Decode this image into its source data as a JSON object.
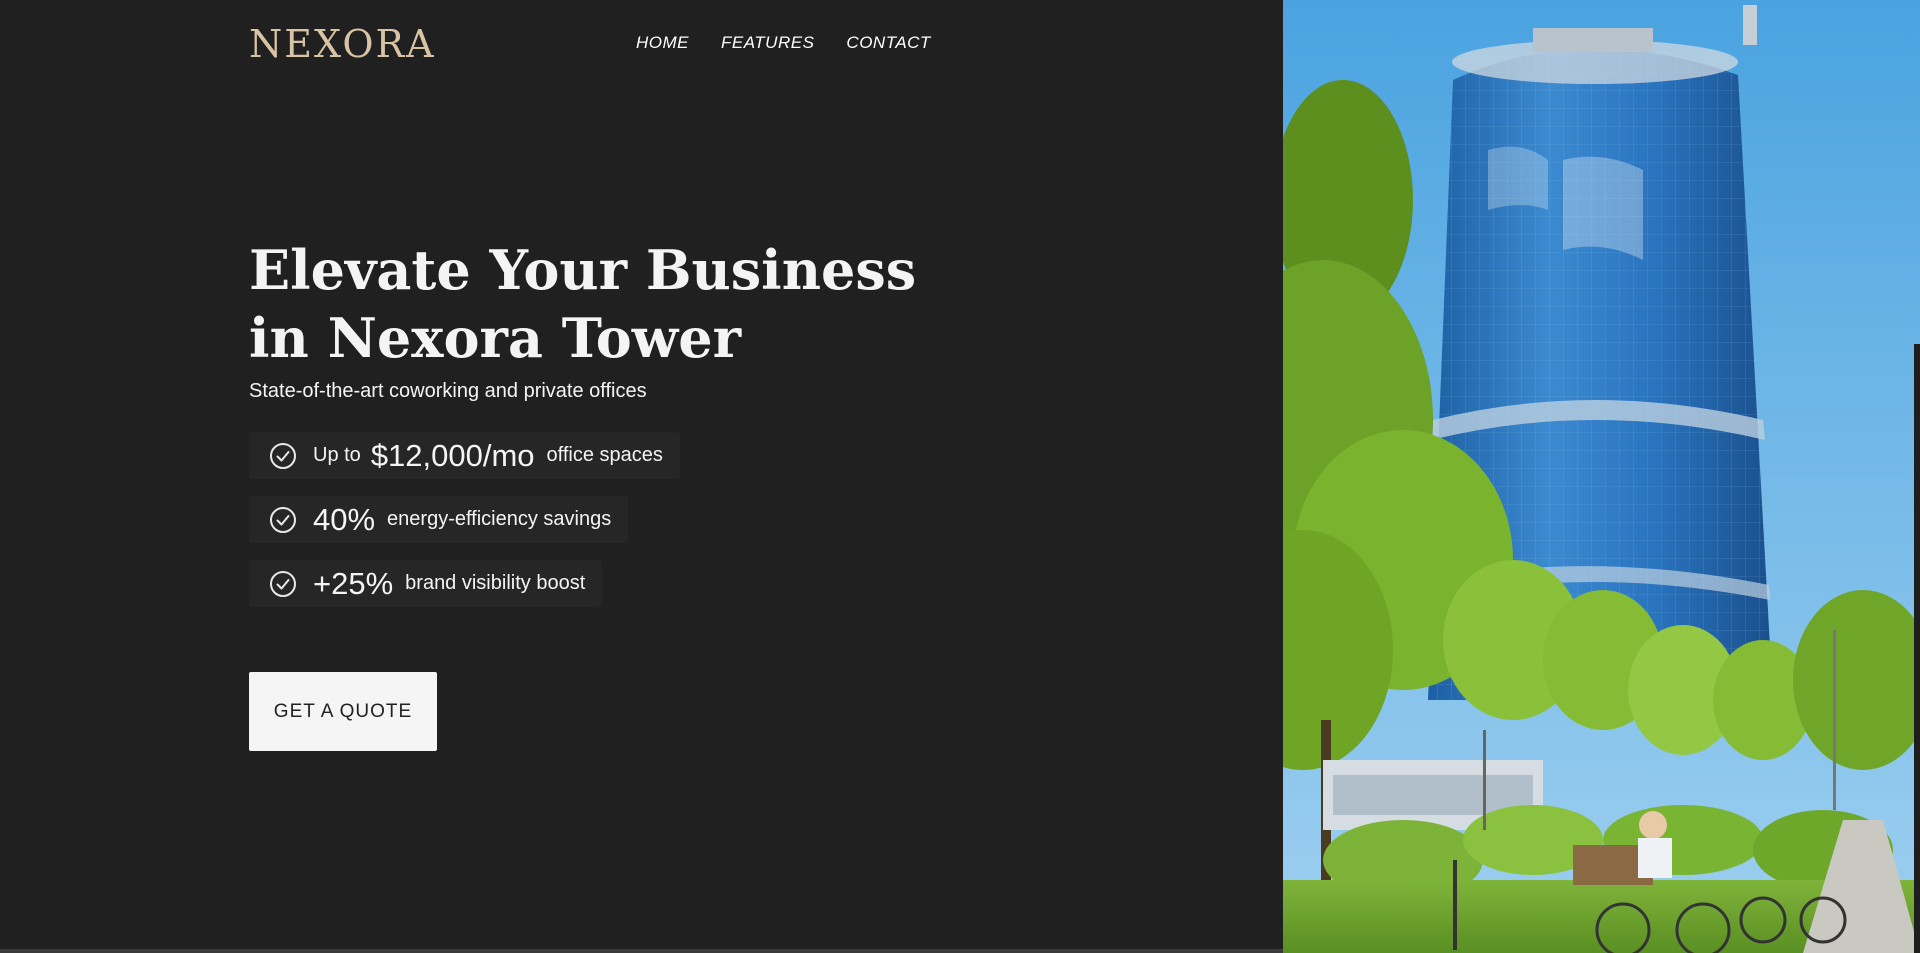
{
  "brand": {
    "logo": "NEXORA",
    "logo_color": "#d8c3a5"
  },
  "nav": {
    "items": [
      "HOME",
      "FEATURES",
      "CONTACT"
    ]
  },
  "hero": {
    "title_line1": "Elevate Your Business",
    "title_line2": "in Nexora Tower",
    "subtitle": "State-of-the-art coworking and private offices"
  },
  "features": [
    {
      "icon": "check-circle-icon",
      "pre": "Up to",
      "big": "$12,000/mo",
      "post": "office spaces"
    },
    {
      "icon": "check-circle-icon",
      "pre": "",
      "big": "40%",
      "post": "energy-efficiency savings"
    },
    {
      "icon": "check-circle-icon",
      "pre": "",
      "big": "+25%",
      "post": "brand visibility boost"
    }
  ],
  "cta": {
    "label": "GET A QUOTE"
  },
  "colors": {
    "background": "#202020",
    "text": "#f4f4f4",
    "feature_bg": "#262626",
    "button_bg": "#f5f5f5"
  },
  "image": {
    "icon": "building-photo"
  }
}
